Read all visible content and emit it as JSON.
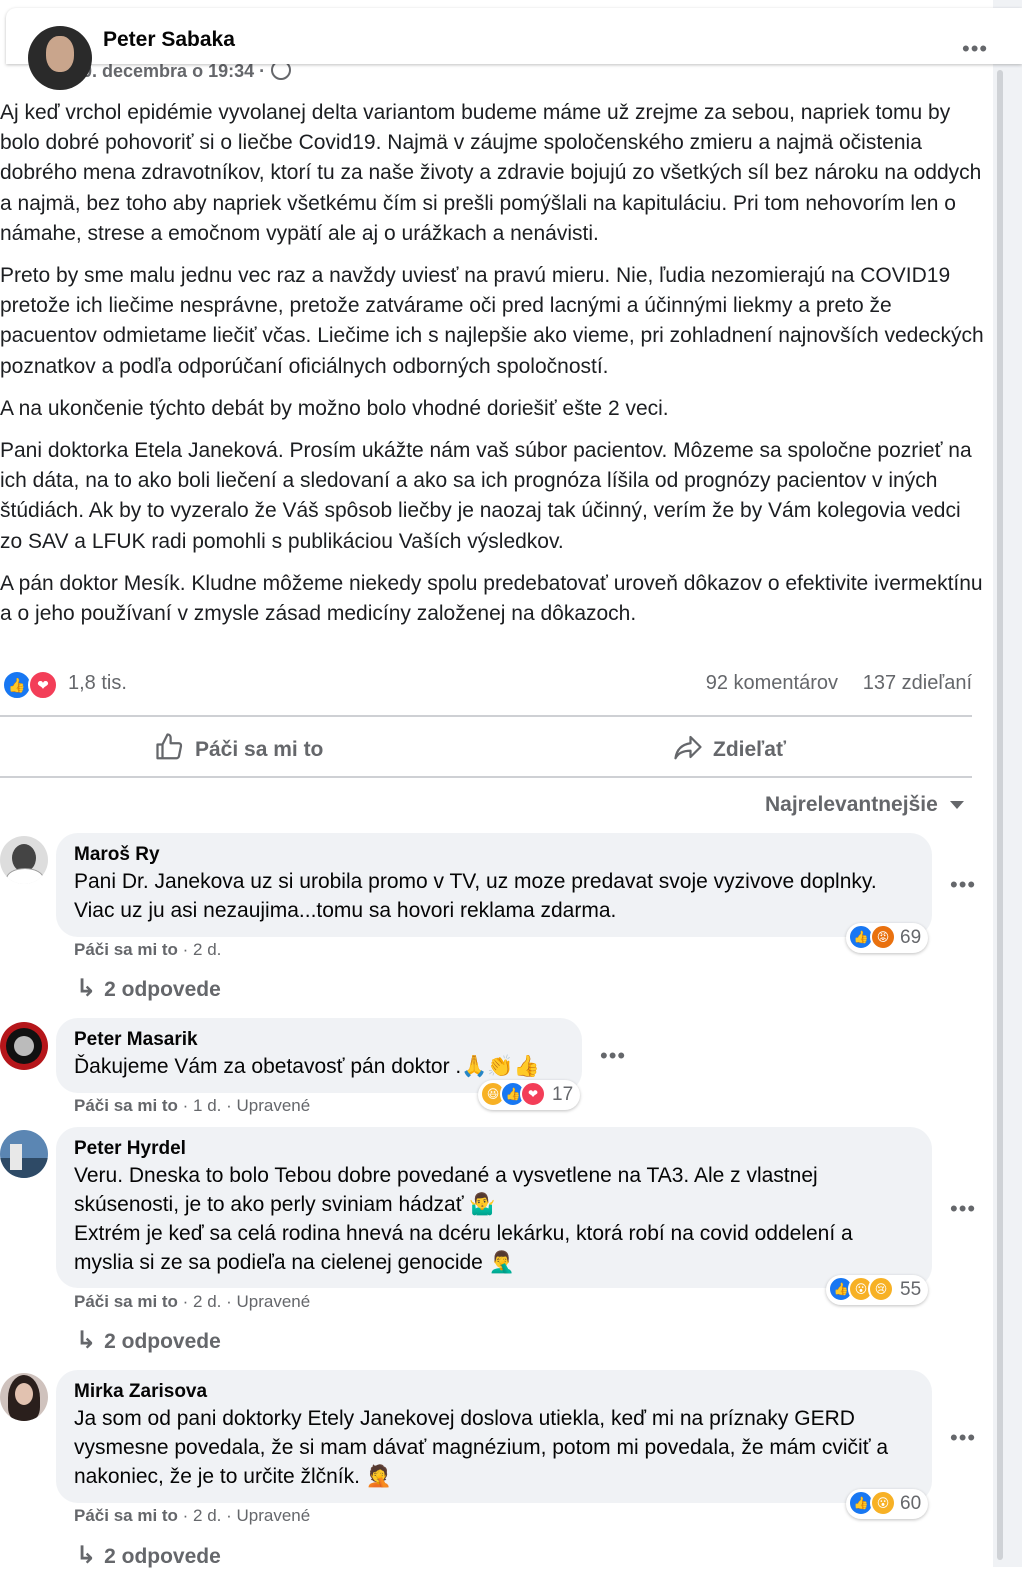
{
  "post": {
    "author": "Peter Sabaka",
    "timestamp": "10. decembra o 19:34 ·",
    "paragraphs": [
      "Aj keď vrchol epidémie vyvolanej delta variantom budeme máme už zrejme za sebou, napriek tomu by bolo dobré pohovoriť si o liečbe Covid19. Najmä v záujme spoločenského zmieru a najmä očistenia dobrého mena zdravotníkov, ktorí tu za naše životy a zdravie bojujú zo všetkých síl bez nároku na oddych a najmä, bez toho aby napriek všetkému čím si prešli pomýšlali na kapituláciu. Pri tom nehovorím len o námahe, strese a emočnom vypätí ale aj o urážkach a nenávisti.",
      "Preto by sme malu jednu vec raz a navždy uviesť na pravú mieru. Nie, ľudia nezomierajú na COVID19 pretože ich liečime nesprávne, pretože zatvárame oči pred lacnými a účinnými liekmy a preto že pacuentov odmietame liečiť včas. Liečime ich s najlepšie ako vieme, pri zohladnení najnovších vedeckých poznatkov a podľa odporúčaní oficiálnych odborných spoločností.",
      "A na ukončenie týchto debát by možno bolo vhodné doriešiť ešte 2 veci.",
      "Pani doktorka Etela Janeková. Prosím ukážte nám vaš súbor pacientov. Môzeme sa spoločne pozrieť na ich dáta, na to ako boli liečení a sledovaní a ako sa ich prognóza líšila od prognózy pacientov v iných štúdiách. Ak by to vyzeralo že Váš spôsob liečby je naozaj tak účinný, verím že by Vám kolegovia vedci zo SAV a LFUK radi pomohli s publikáciou Vaších výsledkov.",
      "A pán doktor Mesík. Kludne môžeme niekedy spolu predebatovať uroveň dôkazov o efektivite ivermektínu a o jeho používaní v zmysle zásad medicíny založenej na dôkazoch."
    ],
    "reactions_count": "1,8 tis.",
    "comments_count": "92 komentárov",
    "shares_count": "137 zdieľaní",
    "like_label": "Páči sa mi to",
    "share_label": "Zdieľať",
    "sort_label": "Najrelevantnejšie"
  },
  "comments": [
    {
      "name": "Maroš Ry",
      "text": "Pani Dr. Janekova uz si urobila promo v TV, uz moze predavat svoje vyzivove doplnky. Viac uz ju asi nezaujima...tomu sa hovori reklama zdarma.",
      "like_label": "Páči sa mi to",
      "meta": " · 2 d.",
      "reaction_count": "69",
      "replies": "2 odpovede"
    },
    {
      "name": "Peter Masarik",
      "text": "Ďakujeme Vám za obetavosť pán doktor .🙏👏👍",
      "like_label": "Páči sa mi to",
      "meta": " · 1 d. · Upravené",
      "reaction_count": "17"
    },
    {
      "name": "Peter Hyrdel",
      "text1": "Veru. Dneska to bolo Tebou dobre povedané a vysvetlene na TA3. Ale z vlastnej skúsenosti, je to ako perly sviniam hádzať 🤷‍♂️",
      "text2": "Extrém je keď sa celá rodina hnevá na dcéru lekárku, ktorá robí na covid oddelení a myslia si ze sa podieľa na cielenej genocide 🤦‍♂️",
      "like_label": "Páči sa mi to",
      "meta": " · 2 d. · Upravené",
      "reaction_count": "55",
      "replies": "2 odpovede"
    },
    {
      "name": "Mirka Zarisova",
      "text": "Ja som od pani doktorky Etely Janekovej doslova utiekla, keď mi na príznaky GERD vysmesne povedala, že si mam dávať magnézium, potom mi povedala, že mám cvičiť a nakoniec, že je to určite žlčník. 🤦",
      "like_label": "Páči sa mi to",
      "meta": " · 2 d. · Upravené",
      "reaction_count": "60",
      "replies": "2 odpovede"
    }
  ],
  "icons": {
    "more": "•••",
    "reply_arrow": "↳",
    "like": "👍",
    "love": "❤",
    "angry": "😡",
    "wow": "😮",
    "haha": "😆",
    "sad": "😢"
  },
  "colors": {
    "like": "#1877f2",
    "love": "#f33e58",
    "muted_text": "#65676b",
    "bubble": "#f0f2f5"
  }
}
